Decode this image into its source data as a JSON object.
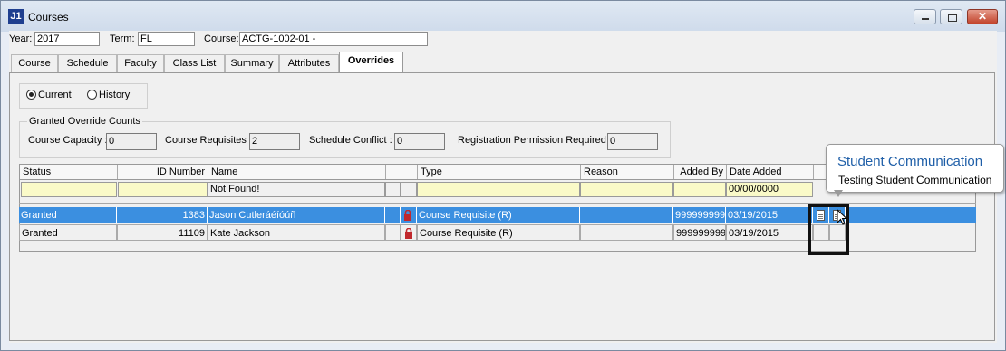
{
  "window": {
    "title": "Courses",
    "app_icon": "J1"
  },
  "header": {
    "year_label": "Year:",
    "year_value": "2017",
    "term_label": "Term:",
    "term_value": "FL",
    "course_label": "Course:",
    "course_value": "ACTG-1002-01 -"
  },
  "tabs": [
    "Course",
    "Schedule",
    "Faculty",
    "Class List",
    "Summary",
    "Attributes",
    "Overrides"
  ],
  "active_tab": "Overrides",
  "view_options": {
    "current": "Current",
    "history": "History",
    "selected": "Current"
  },
  "counts": {
    "group_title": "Granted Override Counts",
    "capacity_label": "Course Capacity :",
    "capacity_value": "0",
    "requisites_label": "Course Requisites :",
    "requisites_value": "2",
    "conflict_label": "Schedule Conflict :",
    "conflict_value": "0",
    "permission_label": "Registration Permission Required :",
    "permission_value": "0"
  },
  "grid": {
    "columns": [
      "Status",
      "ID Number",
      "Name",
      "",
      "",
      "Type",
      "Reason",
      "Added By",
      "Date Added"
    ],
    "filter": {
      "name": "Not Found!",
      "date": "00/00/0000"
    },
    "rows": [
      {
        "status": "Granted",
        "id": "1383",
        "name": "Jason Cutleráéíóúñ",
        "type": "Course Requisite (R)",
        "reason": "",
        "added_by": "999999999",
        "date": "03/19/2015",
        "selected": true
      },
      {
        "status": "Granted",
        "id": "11109",
        "name": "Kate Jackson",
        "type": "Course Requisite (R)",
        "reason": "",
        "added_by": "999999999",
        "date": "03/19/2015",
        "selected": false
      }
    ]
  },
  "tooltip": {
    "title": "Student Communication",
    "body": "Testing Student Communication"
  },
  "colors": {
    "selection": "#3b8fe0",
    "filter_bg": "#fafac8",
    "lock": "#c0282d",
    "tooltip_title": "#1f5fa8"
  },
  "icons": {
    "window_minimize": "minimize-icon",
    "window_maximize": "maximize-icon",
    "window_close": "close-icon",
    "lock": "lock-icon",
    "communication": "document-icon"
  }
}
